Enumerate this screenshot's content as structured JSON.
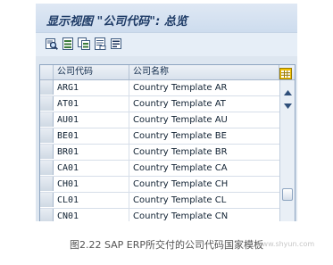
{
  "window": {
    "title": "显示视图 \"公司代码\": 总览"
  },
  "toolbar": {
    "buttons": [
      {
        "icon": "details-magnifier-icon"
      },
      {
        "icon": "new-entries-icon"
      },
      {
        "icon": "copy-icon"
      },
      {
        "icon": "delete-icon"
      },
      {
        "icon": "select-all-icon"
      }
    ]
  },
  "table": {
    "columns": [
      "公司代码",
      "公司名称"
    ],
    "rows": [
      {
        "code": "ARG1",
        "name": "Country Template AR"
      },
      {
        "code": "AT01",
        "name": "Country Template AT"
      },
      {
        "code": "AU01",
        "name": "Country Template AU"
      },
      {
        "code": "BE01",
        "name": "Country Template BE"
      },
      {
        "code": "BR01",
        "name": "Country Template BR"
      },
      {
        "code": "CA01",
        "name": "Country Template CA"
      },
      {
        "code": "CH01",
        "name": "Country Template CH"
      },
      {
        "code": "CL01",
        "name": "Country Template CL"
      },
      {
        "code": "CN01",
        "name": "Country Template CN"
      }
    ],
    "settings_icon": "column-settings-icon"
  },
  "caption": "图2.22 SAP ERP所交付的公司代码国家模板",
  "watermark": "www.shyun.com",
  "colors": {
    "title_text": "#1e3b66",
    "window_bg": "#dfe8f3",
    "grid_border": "#8ea5c1",
    "settings_icon_yellow": "#f2c200"
  }
}
